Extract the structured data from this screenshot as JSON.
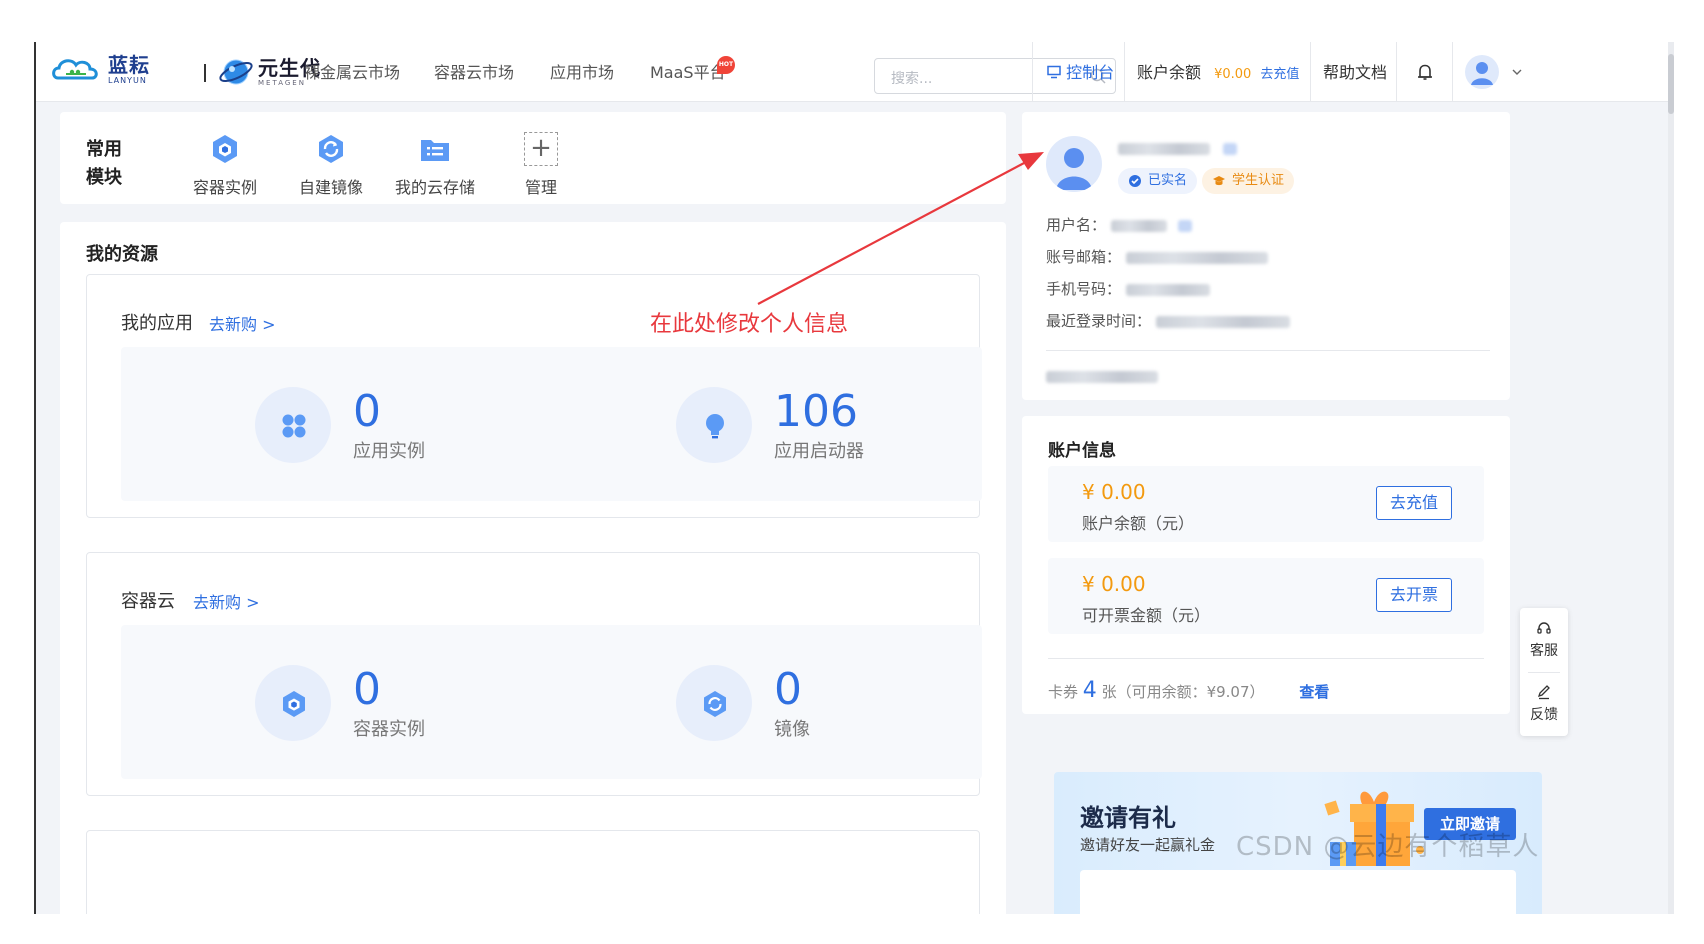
{
  "header": {
    "logo_cn": "蓝耘",
    "logo_en": "LANYUN",
    "logo2_cn": "元生代",
    "logo2_en": "METAGEN",
    "nav": [
      "裸金属云市场",
      "容器云市场",
      "应用市场",
      "MaaS平台"
    ],
    "hot_badge": "HOT",
    "search_placeholder": "搜索...",
    "console": "控制台",
    "balance_label": "账户余额",
    "balance_value": "¥0.00",
    "recharge_link": "去充值>",
    "help": "帮助文档"
  },
  "common": {
    "title": "常用模块",
    "modules": [
      "容器实例",
      "自建镜像",
      "我的云存储"
    ],
    "manage": "管理"
  },
  "resources": {
    "title": "我的资源",
    "apps": {
      "title": "我的应用",
      "link": "去新购 >",
      "stats": [
        {
          "value": "0",
          "label": "应用实例"
        },
        {
          "value": "106",
          "label": "应用启动器"
        }
      ]
    },
    "container": {
      "title": "容器云",
      "link": "去新购 >",
      "stats": [
        {
          "value": "0",
          "label": "容器实例"
        },
        {
          "value": "0",
          "label": "镜像"
        }
      ]
    }
  },
  "annotation": "在此处修改个人信息",
  "profile": {
    "tag_verified": "已实名",
    "tag_student": "学生认证",
    "fields": [
      "用户名：",
      "账号邮箱：",
      "手机号码：",
      "最近登录时间："
    ]
  },
  "account": {
    "title": "账户信息",
    "balance_amount": "¥ 0.00",
    "balance_label": "账户余额（元）",
    "recharge_btn": "去充值",
    "invoice_amount": "¥ 0.00",
    "invoice_label": "可开票金额（元）",
    "invoice_btn": "去开票",
    "coupon_pre": "卡券",
    "coupon_count": "4",
    "coupon_post": "张（可用余额：¥9.07）",
    "coupon_view": "查看"
  },
  "invite": {
    "title": "邀请有礼",
    "subtitle": "邀请好友一起赢礼金",
    "button": "立即邀请"
  },
  "side": {
    "service": "客服",
    "feedback": "反馈"
  },
  "watermark": "CSDN @云边有个稻草人"
}
